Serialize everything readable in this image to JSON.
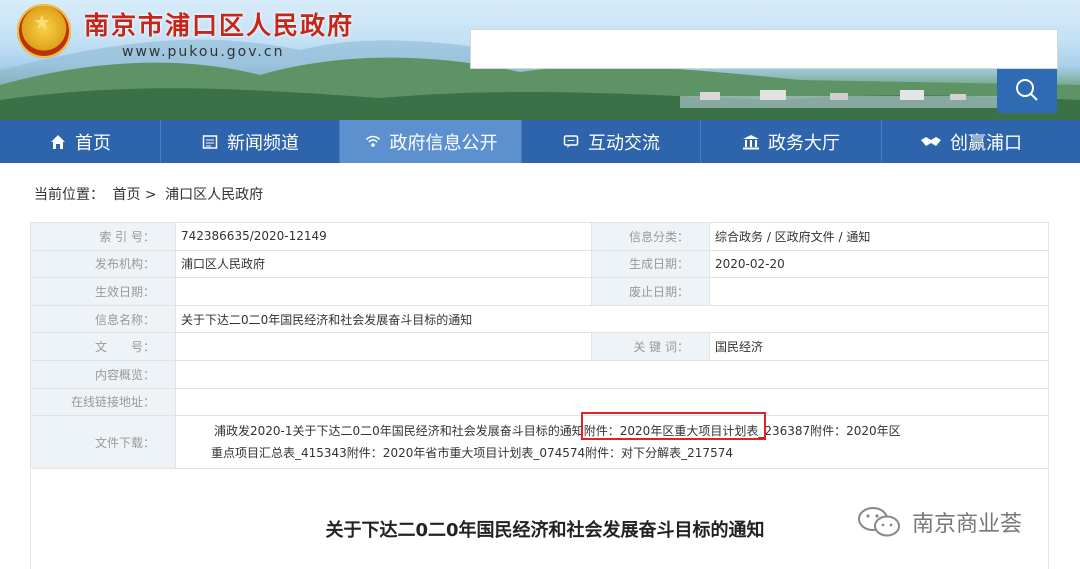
{
  "site": {
    "title": "南京市浦口区人民政府",
    "url": "www.pukou.gov.cn"
  },
  "search": {
    "placeholder": "",
    "button_icon": "search-icon"
  },
  "nav": [
    {
      "label": "首页",
      "icon": "home-icon"
    },
    {
      "label": "新闻频道",
      "icon": "news-icon"
    },
    {
      "label": "政府信息公开",
      "icon": "broadcast-icon",
      "active": true
    },
    {
      "label": "互动交流",
      "icon": "chat-icon"
    },
    {
      "label": "政务大厅",
      "icon": "hall-icon"
    },
    {
      "label": "创赢浦口",
      "icon": "handshake-icon"
    }
  ],
  "breadcrumb": {
    "prefix": "当前位置：",
    "home": "首页",
    "sep": ">",
    "current": "浦口区人民政府"
  },
  "info": {
    "index_label": "索 引 号：",
    "index_value": "742386635/2020-12149",
    "category_label": "信息分类：",
    "category_value": "综合政务 / 区政府文件 / 通知",
    "publisher_label": "发布机构：",
    "publisher_value": "浦口区人民政府",
    "created_label": "生成日期：",
    "created_value": "2020-02-20",
    "effective_label": "生效日期：",
    "effective_value": "",
    "expire_label": "废止日期：",
    "expire_value": "",
    "name_label": "信息名称：",
    "name_value": "关于下达二0二0年国民经济和社会发展奋斗目标的通知",
    "doc_label": "文　　号：",
    "doc_value": "",
    "keyword_label": "关 键 词：",
    "keyword_value": "国民经济",
    "summary_label": "内容概览：",
    "summary_value": "",
    "link_label": "在线链接地址：",
    "link_value": "",
    "download_label": "文件下载：",
    "download_line1": "浦政发2020-1关于下达二0二0年国民经济和社会发展奋斗目标的通知附件：2020年区重大项目计划表_236387附件：2020年区",
    "download_line2": "重点项目汇总表_415343附件：2020年省市重大项目计划表_074574附件：对下分解表_217574"
  },
  "article": {
    "title": "关于下达二0二0年国民经济和社会发展奋斗目标的通知"
  },
  "watermark": {
    "text": "南京商业荟",
    "icon": "wechat-icon"
  },
  "colors": {
    "nav_bg": "#2d64ab",
    "nav_active": "#5d90cf",
    "title_red": "#c5261b",
    "label_bg": "#eef3f7",
    "highlight": "#e52222"
  }
}
